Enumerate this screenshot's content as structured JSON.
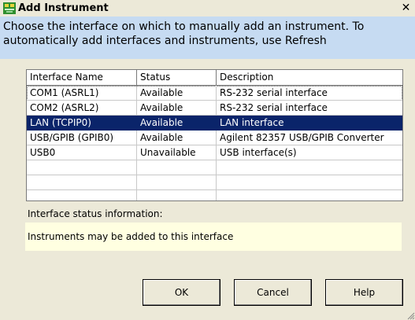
{
  "window": {
    "title": "Add Instrument",
    "close_symbol": "✕",
    "app_icon": "instrument-icon"
  },
  "instructions": {
    "line1": "Choose the interface on which to manually add an instrument.  To",
    "line2": "automatically add interfaces and instruments, use Refresh"
  },
  "table": {
    "headers": [
      "Interface Name",
      "Status",
      "Description"
    ],
    "rows": [
      {
        "name": "COM1 (ASRL1)",
        "status": "Available",
        "description": "RS-232 serial interface"
      },
      {
        "name": "COM2 (ASRL2)",
        "status": "Available",
        "description": "RS-232 serial interface"
      },
      {
        "name": "LAN (TCPIP0)",
        "status": "Available",
        "description": "LAN interface"
      },
      {
        "name": "USB/GPIB (GPIB0)",
        "status": "Available",
        "description": "Agilent 82357 USB/GPIB Converter"
      },
      {
        "name": "USB0",
        "status": "Unavailable",
        "description": "USB interface(s)"
      }
    ],
    "selected_row": 2,
    "colors": {
      "selection": "#0a246a",
      "header_border": "#7a7a7a"
    }
  },
  "status": {
    "label": "Interface status information:",
    "message": "Instruments may be added to this interface",
    "background": "#ffffe1"
  },
  "buttons": {
    "ok": "OK",
    "cancel": "Cancel",
    "help": "Help"
  },
  "colors": {
    "instructions_bg": "#c6dbf2",
    "dialog_bg": "#ece9d8"
  }
}
